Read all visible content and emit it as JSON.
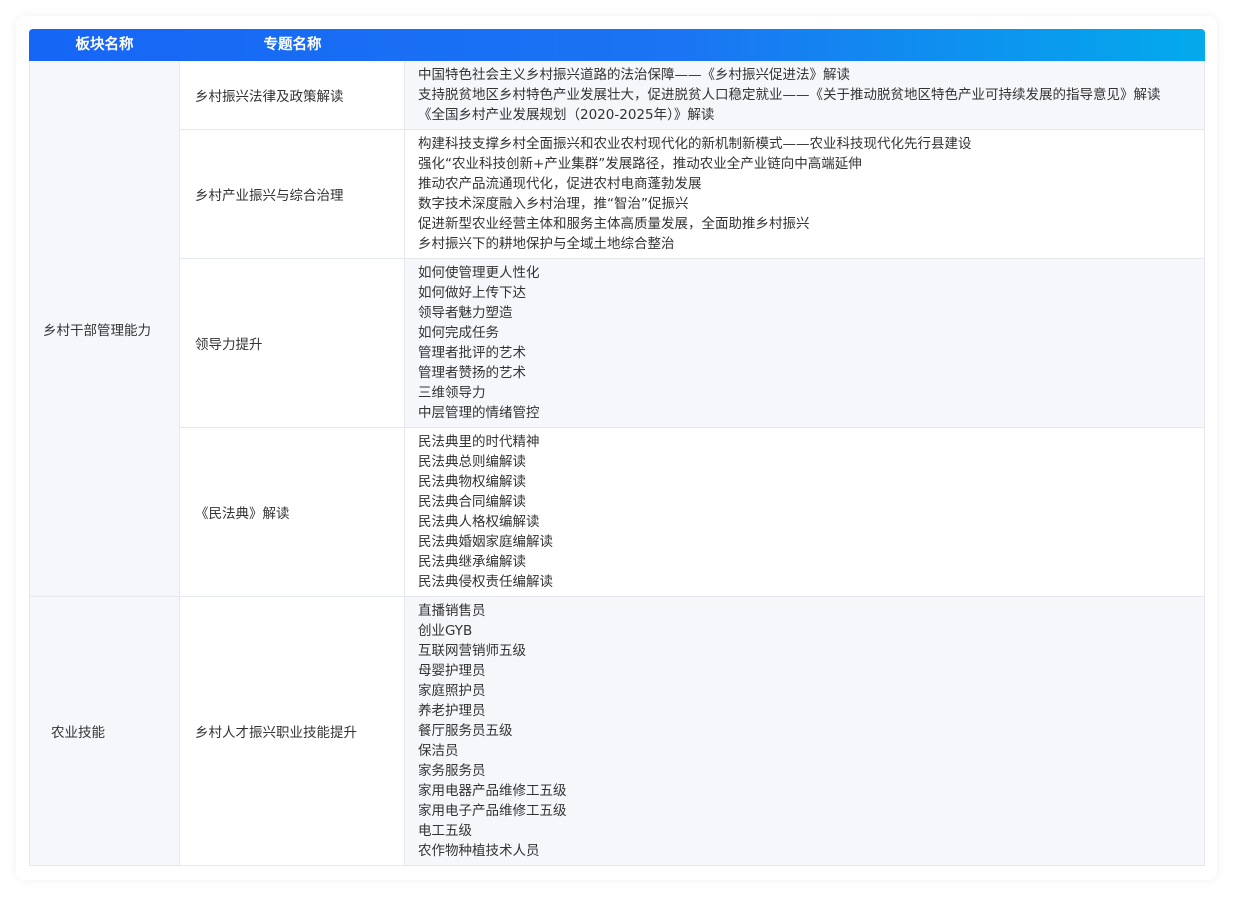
{
  "header": {
    "col1": "板块名称",
    "col2": "专题名称"
  },
  "sections": [
    {
      "block": "乡村干部管理能力",
      "topics": [
        {
          "name": "乡村振兴法律及政策解读",
          "items": [
            "中国特色社会主义乡村振兴道路的法治保障——《乡村振兴促进法》解读",
            "支持脱贫地区乡村特色产业发展壮大，促进脱贫人口稳定就业——《关于推动脱贫地区特色产业可持续发展的指导意见》解读",
            "《全国乡村产业发展规划（2020-2025年）》解读"
          ]
        },
        {
          "name": "乡村产业振兴与综合治理",
          "items": [
            "构建科技支撑乡村全面振兴和农业农村现代化的新机制新模式——农业科技现代化先行县建设",
            "强化“农业科技创新+产业集群”发展路径，推动农业全产业链向中高端延伸",
            "推动农产品流通现代化，促进农村电商蓬勃发展",
            "数字技术深度融入乡村治理，推“智治”促振兴",
            "促进新型农业经营主体和服务主体高质量发展，全面助推乡村振兴",
            "乡村振兴下的耕地保护与全域土地综合整治"
          ]
        },
        {
          "name": "领导力提升",
          "items": [
            "如何使管理更人性化",
            "如何做好上传下达",
            "领导者魅力塑造",
            "如何完成任务",
            "管理者批评的艺术",
            "管理者赞扬的艺术",
            "三维领导力",
            "中层管理的情绪管控"
          ]
        },
        {
          "name": "《民法典》解读",
          "items": [
            "民法典里的时代精神",
            "民法典总则编解读",
            "民法典物权编解读",
            "民法典合同编解读",
            "民法典人格权编解读",
            "民法典婚姻家庭编解读",
            "民法典继承编解读",
            "民法典侵权责任编解读"
          ]
        }
      ]
    },
    {
      "block": "农业技能",
      "topics": [
        {
          "name": "乡村人才振兴职业技能提升",
          "items": [
            "直播销售员",
            "创业GYB",
            "互联网营销师五级",
            "母婴护理员",
            "家庭照护员",
            "养老护理员",
            "餐厅服务员五级",
            "保洁员",
            "家务服务员",
            "家用电器产品维修工五级",
            "家用电子产品维修工五级",
            "电工五级",
            "农作物种植技术人员"
          ]
        }
      ]
    }
  ]
}
